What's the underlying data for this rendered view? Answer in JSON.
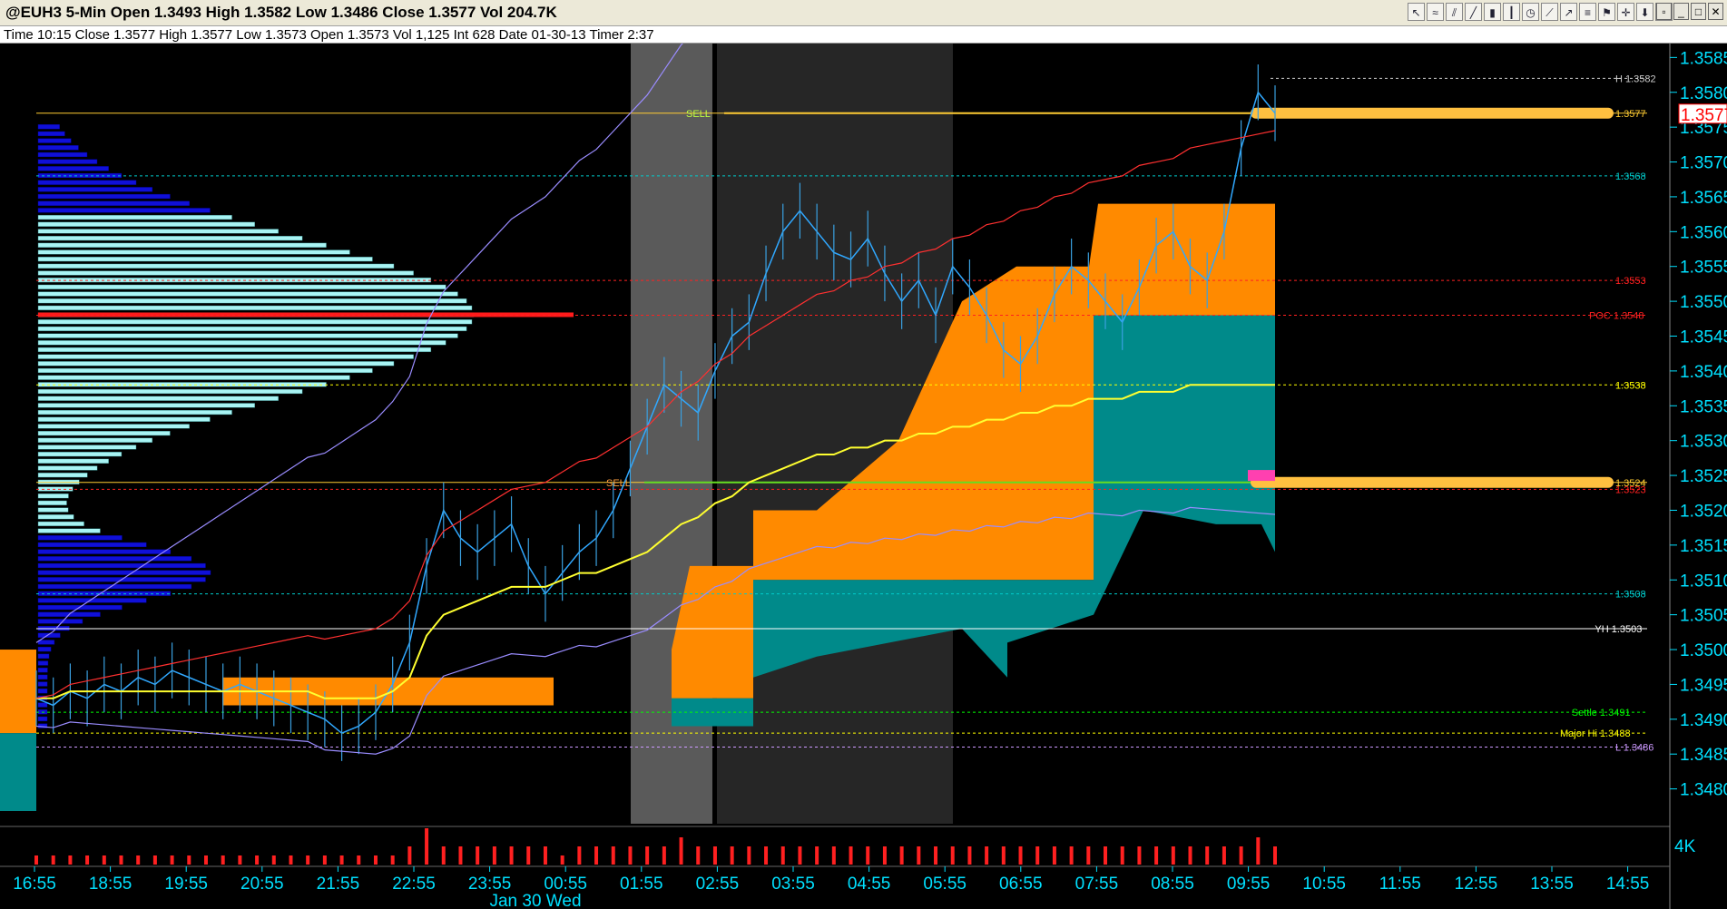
{
  "window": {
    "title": "@EUH3 5-Min Open 1.3493 High 1.3582 Low 1.3486 Close 1.3577 Vol 204.7K",
    "info": "Time 10:15   Close 1.3577   High 1.3577   Low 1.3573   Open 1.3573   Vol 1,125   Int 628   Date 01-30-13   Timer 2:37"
  },
  "toolbar": [
    {
      "name": "cursor-icon",
      "glyph": "↖"
    },
    {
      "name": "wave-icon",
      "glyph": "≈"
    },
    {
      "name": "channel-icon",
      "glyph": "⫽"
    },
    {
      "name": "line-icon",
      "glyph": "╱"
    },
    {
      "name": "bar-chart-icon",
      "glyph": "▮"
    },
    {
      "name": "candle-icon",
      "glyph": "┃"
    },
    {
      "name": "clock-icon",
      "glyph": "◷"
    },
    {
      "name": "trendline-icon",
      "glyph": "⟋"
    },
    {
      "name": "ray-icon",
      "glyph": "↗"
    },
    {
      "name": "fib-icon",
      "glyph": "≡"
    },
    {
      "name": "marker-icon",
      "glyph": "⚑"
    },
    {
      "name": "cross-icon",
      "glyph": "✛"
    },
    {
      "name": "arrow-down-icon",
      "glyph": "⬇"
    },
    {
      "name": "lock-icon",
      "glyph": "⊡"
    }
  ],
  "window_buttons": [
    {
      "name": "restore-button",
      "glyph": "▫"
    },
    {
      "name": "minimize-button",
      "glyph": "_"
    },
    {
      "name": "maximize-button",
      "glyph": "□"
    },
    {
      "name": "close-button",
      "glyph": "✕"
    }
  ],
  "chart_data": {
    "type": "line",
    "ylim": [
      1.3475,
      1.3587
    ],
    "y_ticks": [
      "1.3585",
      "1.3580",
      "1.3575",
      "1.3570",
      "1.3565",
      "1.3560",
      "1.3555",
      "1.3550",
      "1.3545",
      "1.3540",
      "1.3535",
      "1.3530",
      "1.3525",
      "1.3520",
      "1.3515",
      "1.3510",
      "1.3505",
      "1.3500",
      "1.3495",
      "1.3490",
      "1.3485",
      "1.3480"
    ],
    "x_ticks": [
      "16:55",
      "18:55",
      "19:55",
      "20:55",
      "21:55",
      "22:55",
      "23:55",
      "00:55",
      "01:55",
      "02:55",
      "03:55",
      "04:55",
      "05:55",
      "06:55",
      "07:55",
      "08:55",
      "09:55",
      "10:55",
      "11:55",
      "12:55",
      "13:55",
      "14:55"
    ],
    "date_label": "Jan 30 Wed",
    "last_price": "1.3577",
    "volume_label": "4K",
    "levels": [
      {
        "label": "H 1.3582",
        "value": 1.3582,
        "color": "#cccccc"
      },
      {
        "label": "1.3577",
        "value": 1.3577,
        "color": "#ffcc33"
      },
      {
        "label": "1.3568",
        "value": 1.3568,
        "color": "#00cccc"
      },
      {
        "label": "1.3553",
        "value": 1.3553,
        "color": "#ff2020"
      },
      {
        "label": "POC 1.3548",
        "value": 1.3548,
        "color": "#ff2020"
      },
      {
        "label": "1.3538",
        "value": 1.3538,
        "color": "#ffff00"
      },
      {
        "label": "1.3524",
        "value": 1.3524,
        "color": "#ffcc33"
      },
      {
        "label": "1.3523",
        "value": 1.3523,
        "color": "#ff2020"
      },
      {
        "label": "1.3508",
        "value": 1.3508,
        "color": "#00cccc"
      },
      {
        "label": "YH 1.3503",
        "value": 1.3503,
        "color": "#ffffff"
      },
      {
        "label": "Settle 1.3491",
        "value": 1.3491,
        "color": "#00ff00"
      },
      {
        "label": "Major Hi 1.3488",
        "value": 1.3488,
        "color": "#ffff00"
      },
      {
        "label": "L 1.3486",
        "value": 1.3486,
        "color": "#cc99ff"
      }
    ],
    "sell_signals": [
      {
        "label": "SELL",
        "value": 1.3577
      },
      {
        "label": "SELL",
        "value": 1.3524
      }
    ],
    "price_path": [
      1.3493,
      1.3492,
      1.3494,
      1.3493,
      1.3495,
      1.3494,
      1.3496,
      1.3495,
      1.3497,
      1.3496,
      1.3495,
      1.3494,
      1.3495,
      1.3494,
      1.3493,
      1.3492,
      1.3491,
      1.349,
      1.3488,
      1.3489,
      1.3491,
      1.3495,
      1.3501,
      1.3512,
      1.352,
      1.3516,
      1.3514,
      1.3516,
      1.3518,
      1.3512,
      1.3508,
      1.3511,
      1.3514,
      1.3516,
      1.352,
      1.3526,
      1.3532,
      1.3538,
      1.3536,
      1.3534,
      1.354,
      1.3545,
      1.3547,
      1.3554,
      1.356,
      1.3563,
      1.356,
      1.3557,
      1.3556,
      1.3559,
      1.3554,
      1.355,
      1.3553,
      1.3548,
      1.3555,
      1.3552,
      1.3548,
      1.3543,
      1.3541,
      1.3545,
      1.3551,
      1.3555,
      1.3553,
      1.355,
      1.3547,
      1.3552,
      1.3558,
      1.356,
      1.3555,
      1.3553,
      1.356,
      1.3572,
      1.358,
      1.3577
    ],
    "vwap": [
      1.3493,
      1.3493,
      1.3494,
      1.3494,
      1.3494,
      1.3494,
      1.3494,
      1.3494,
      1.3494,
      1.3494,
      1.3494,
      1.3494,
      1.3494,
      1.3494,
      1.3494,
      1.3494,
      1.3494,
      1.3493,
      1.3493,
      1.3493,
      1.3493,
      1.3494,
      1.3496,
      1.3502,
      1.3505,
      1.3506,
      1.3507,
      1.3508,
      1.3509,
      1.3509,
      1.3509,
      1.351,
      1.3511,
      1.3511,
      1.3512,
      1.3513,
      1.3514,
      1.3516,
      1.3518,
      1.3519,
      1.3521,
      1.3522,
      1.3524,
      1.3525,
      1.3526,
      1.3527,
      1.3528,
      1.3528,
      1.3529,
      1.3529,
      1.353,
      1.353,
      1.3531,
      1.3531,
      1.3532,
      1.3532,
      1.3533,
      1.3533,
      1.3534,
      1.3534,
      1.3535,
      1.3535,
      1.3536,
      1.3536,
      1.3536,
      1.3537,
      1.3537,
      1.3537,
      1.3538,
      1.3538,
      1.3538,
      1.3538,
      1.3538,
      1.3538
    ],
    "volume": [
      1,
      1,
      1,
      1,
      1,
      1,
      1,
      1,
      1,
      1,
      1,
      1,
      1,
      1,
      1,
      1,
      1,
      1,
      1,
      1,
      1,
      1,
      2,
      4,
      2,
      2,
      2,
      2,
      2,
      2,
      2,
      1,
      2,
      2,
      2,
      2,
      2,
      2,
      3,
      2,
      2,
      2,
      2,
      2,
      2,
      2,
      2,
      2,
      2,
      2,
      2,
      2,
      2,
      2,
      2,
      2,
      2,
      2,
      2,
      2,
      2,
      2,
      2,
      2,
      2,
      2,
      2,
      2,
      2,
      2,
      2,
      2,
      3,
      2
    ]
  }
}
